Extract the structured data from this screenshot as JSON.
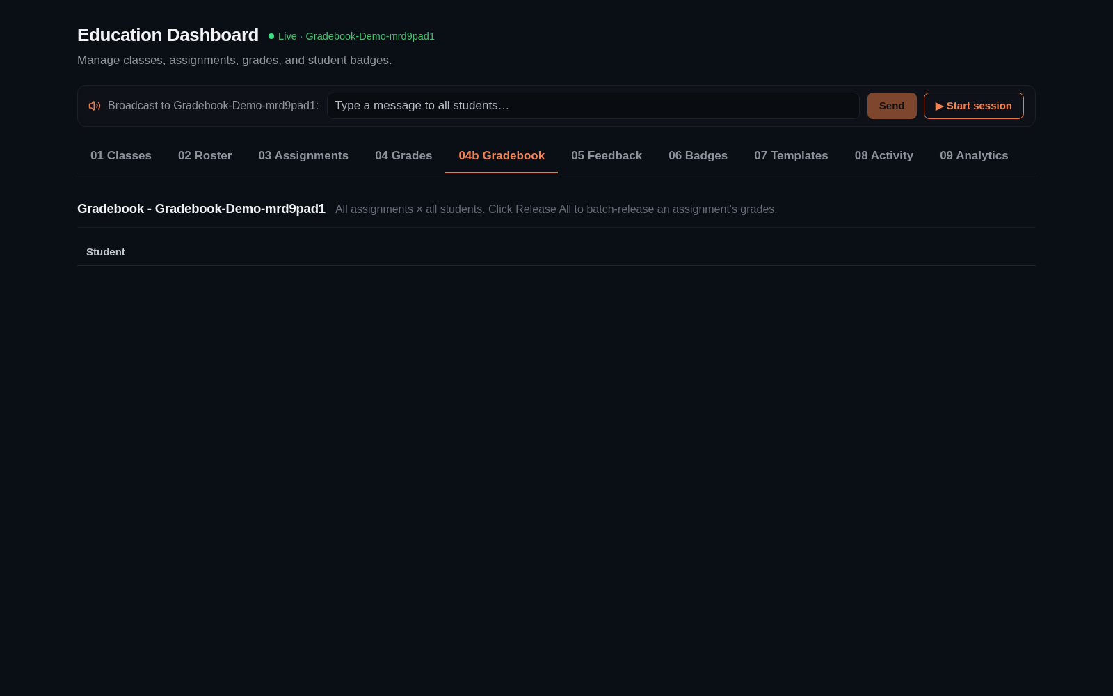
{
  "header": {
    "title": "Education Dashboard",
    "status": {
      "label": "Live · Gradebook-Demo-mrd9pad1",
      "live": true
    },
    "subtitle": "Manage classes, assignments, grades, and student badges."
  },
  "broadcast": {
    "label": "Broadcast to Gradebook-Demo-mrd9pad1:",
    "placeholder": "Type a message to all students…",
    "send_button": {
      "label": "Send",
      "disabled": true
    },
    "session_button": {
      "label": "▶ Start session"
    }
  },
  "tabs": [
    {
      "label": "01 Classes",
      "selected": false
    },
    {
      "label": "02 Roster",
      "selected": false
    },
    {
      "label": "03 Assignments",
      "selected": false
    },
    {
      "label": "04 Grades",
      "selected": false
    },
    {
      "label": "04b Gradebook",
      "selected": true
    },
    {
      "label": "05 Feedback",
      "selected": false
    },
    {
      "label": "06 Badges",
      "selected": false
    },
    {
      "label": "07 Templates",
      "selected": false
    },
    {
      "label": "08 Activity",
      "selected": false
    },
    {
      "label": "09 Analytics",
      "selected": false
    }
  ],
  "gradebook": {
    "title": "Gradebook - Gradebook-Demo-mrd9pad1",
    "description": "All assignments × all students. Click Release All to batch-release an assignment's grades.",
    "columns": [
      "Student"
    ]
  }
}
